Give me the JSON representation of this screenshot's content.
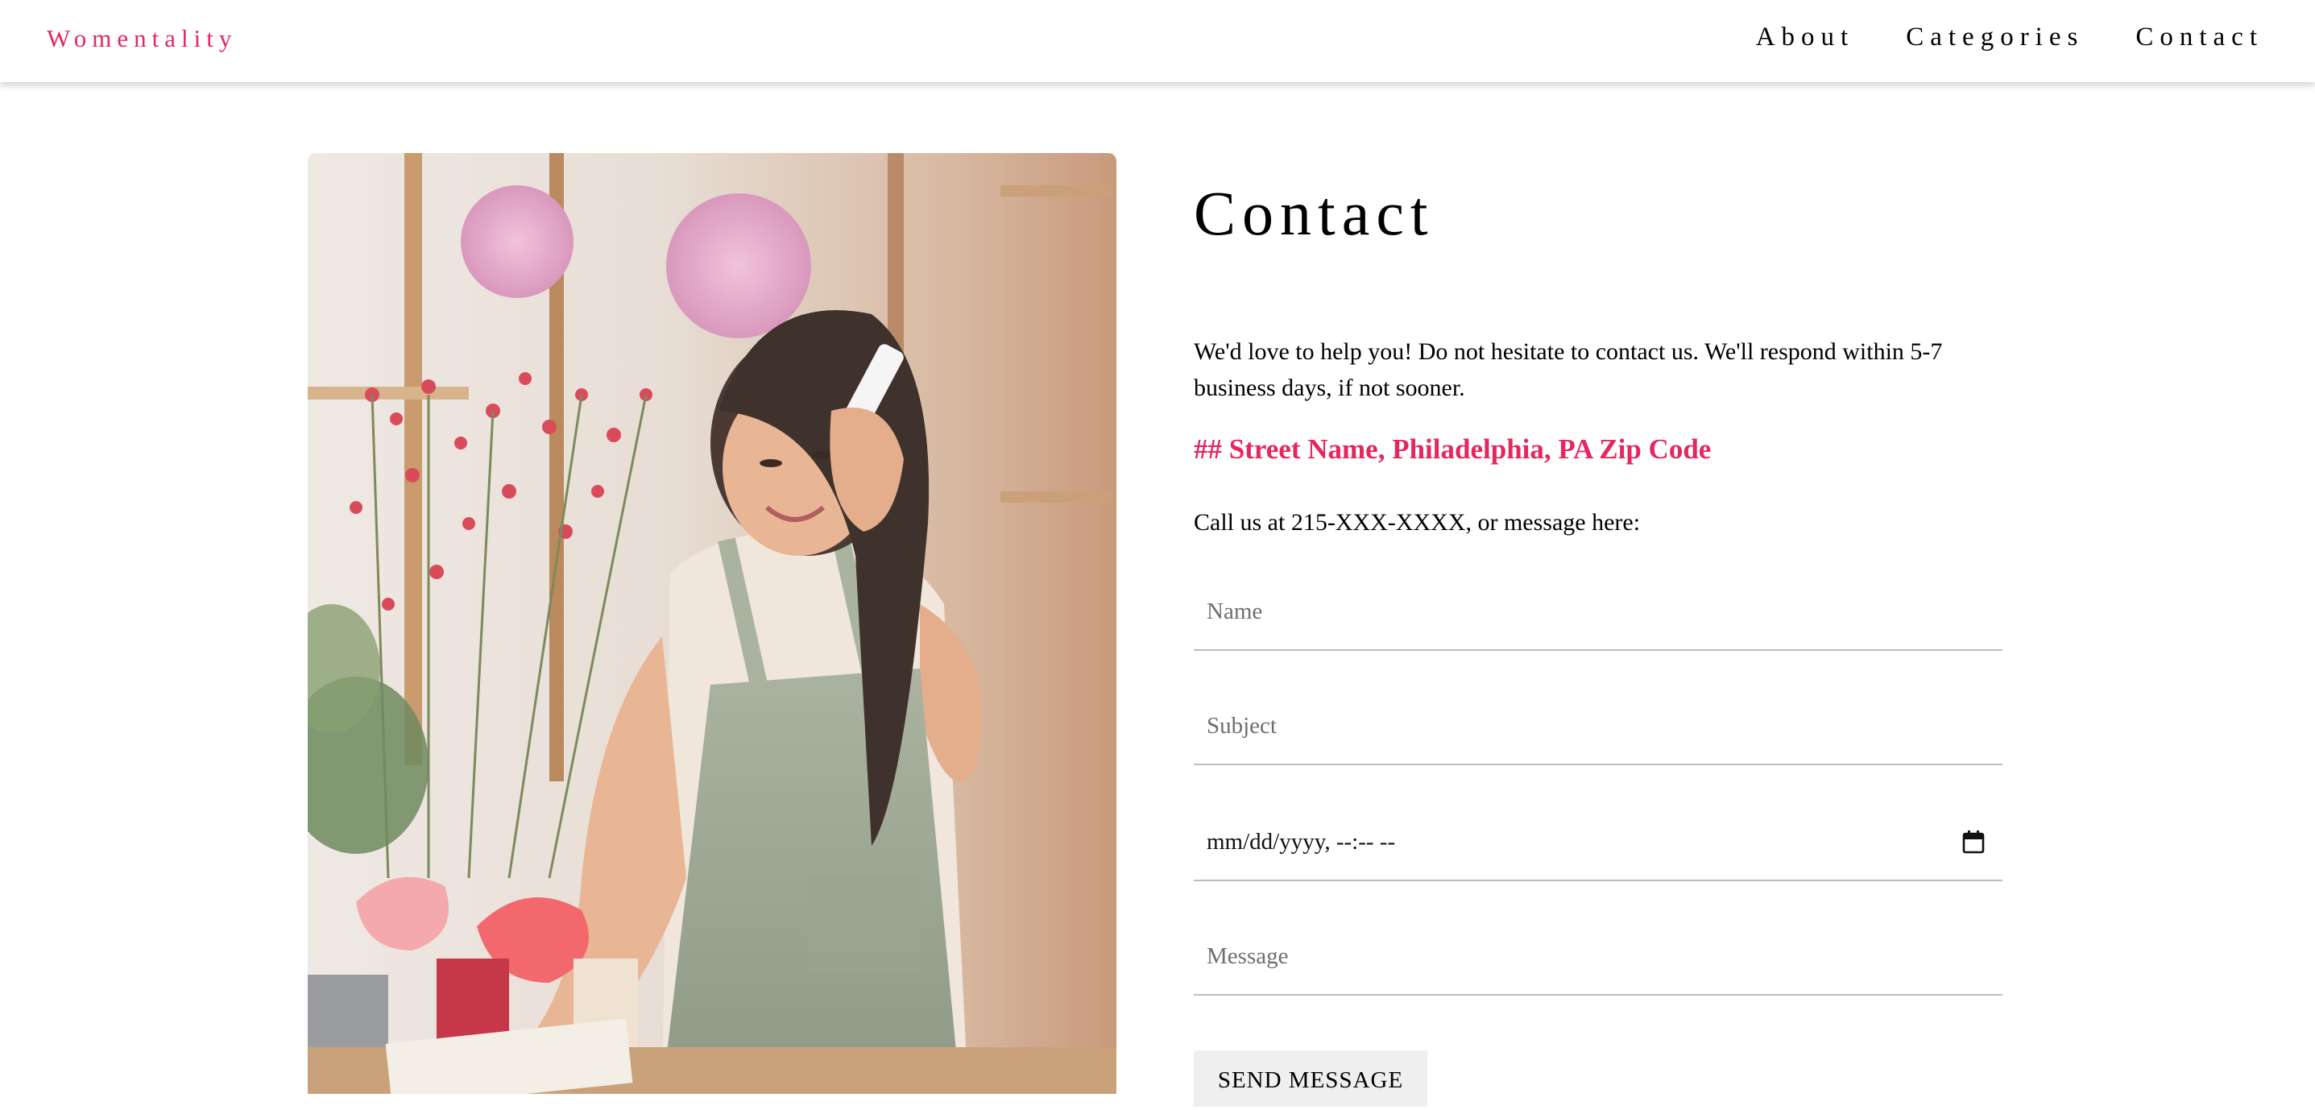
{
  "header": {
    "brand": "Womentality",
    "nav": [
      "About",
      "Categories",
      "Contact"
    ]
  },
  "hero_image": {
    "description": "woman florist in apron talking on phone in flower shop"
  },
  "contact": {
    "title": "Contact",
    "intro": "We'd love to help you! Do not hesitate to contact us. We'll respond within 5-7 business days, if not sooner.",
    "address": "## Street Name, Philadelphia, PA Zip Code",
    "call": "Call us at 215-XXX-XXXX, or message here:",
    "form": {
      "name_placeholder": "Name",
      "subject_placeholder": "Subject",
      "datetime_value": "mm/dd/yyyy, --:-- --",
      "message_placeholder": "Message",
      "submit_label": "SEND MESSAGE"
    }
  },
  "colors": {
    "accent": "#e5275f",
    "button_bg": "#efefef",
    "divider": "#bdbdbd"
  },
  "icons": {
    "calendar": "calendar-icon"
  }
}
